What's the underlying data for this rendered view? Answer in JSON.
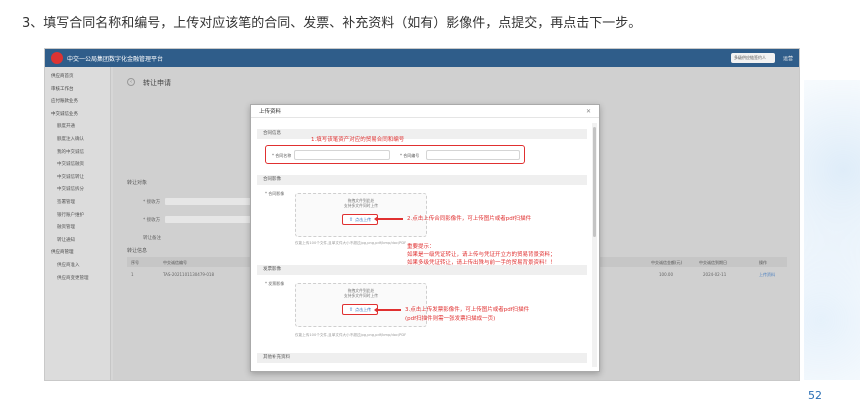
{
  "slide": {
    "heading": "3、填写合同名称和编号，上传对应该笔的合同、发票、补充资料（如有）影像件，点提交，再点击下一步。",
    "page_number": "52"
  },
  "app": {
    "title": "中交一公局集团数字化金融管理平台",
    "org_select": "多级供应链签约人",
    "user": "运营"
  },
  "sidebar": {
    "items": [
      {
        "label": "供应商首页",
        "group": true
      },
      {
        "label": "审核工作台",
        "group": true
      },
      {
        "label": "应付账款业务",
        "group": true
      },
      {
        "label": "中交诚信业务",
        "group": true
      },
      {
        "label": "额度开通",
        "group": false
      },
      {
        "label": "额度注入确认",
        "group": false
      },
      {
        "label": "我的中交诚信",
        "group": false
      },
      {
        "label": "中交诚信融资",
        "group": false
      },
      {
        "label": "中交诚信转让",
        "group": false
      },
      {
        "label": "中交诚信拆分",
        "group": false
      },
      {
        "label": "签署管理",
        "group": false
      },
      {
        "label": "银行账户维护",
        "group": false
      },
      {
        "label": "融资管理",
        "group": false
      },
      {
        "label": "转让通知",
        "group": false
      },
      {
        "label": "供应商管理",
        "group": true
      },
      {
        "label": "供应商准入",
        "group": false
      },
      {
        "label": "供应商变更管理",
        "group": false
      }
    ]
  },
  "main": {
    "page_title": "转让申请",
    "section_transfer_target": "转让对象",
    "field_labels": [
      "* 接收方",
      "* 接收方",
      "转让备注"
    ],
    "section_transfer_info": "转让信息",
    "table_headers": [
      "序号",
      "中交诚信编号",
      "中交诚信金额(元)",
      "中交诚信到期日",
      "操作"
    ],
    "table_row": [
      "1",
      "TAS-2021101130479-018",
      "100.00",
      "2024-02-11",
      "上传资料"
    ]
  },
  "modal": {
    "title": "上传资料",
    "section_contract": "合同信息",
    "contract_name_label": "* 合同名称",
    "contract_number_label": "* 合同编号",
    "section_contract_image": "合同影像",
    "contract_image_label": "* 合同影像",
    "section_invoice_image": "发票影像",
    "invoice_image_label": "* 发票影像",
    "section_supplement": "其他补充资料",
    "upload_hint_1": "拖拽文件到此处",
    "upload_hint_2": "支持多文件同时上传",
    "upload_button": "点击上传",
    "format_note": "仅能上传100个文件,且单文件大小不超过jpg,png,pdf/bmp/doc/PDF"
  },
  "annotations": {
    "a1": "1.填写该笔资产对应的贸易合同和编号",
    "a2": "2.点击上传合同影像件，可上传图片或者pdf扫描件",
    "a3_title": "重要提示：",
    "a3_line1": "如果是一级凭证转让，请上传与凭证开立方的贸易背景资料；",
    "a3_line2": "如果多级凭证转让，请上传出殊与前一手的贸易背景资料！！",
    "a4_line1": "3.点击上传发票影像件，可上传图片或者pdf扫描件",
    "a4_line2": "(pdf扫描件则需一张发票扫描成一页)"
  },
  "colors": {
    "accent_red": "#e03030",
    "header_blue": "#2f5d8a",
    "link_blue": "#2f6fc0"
  }
}
